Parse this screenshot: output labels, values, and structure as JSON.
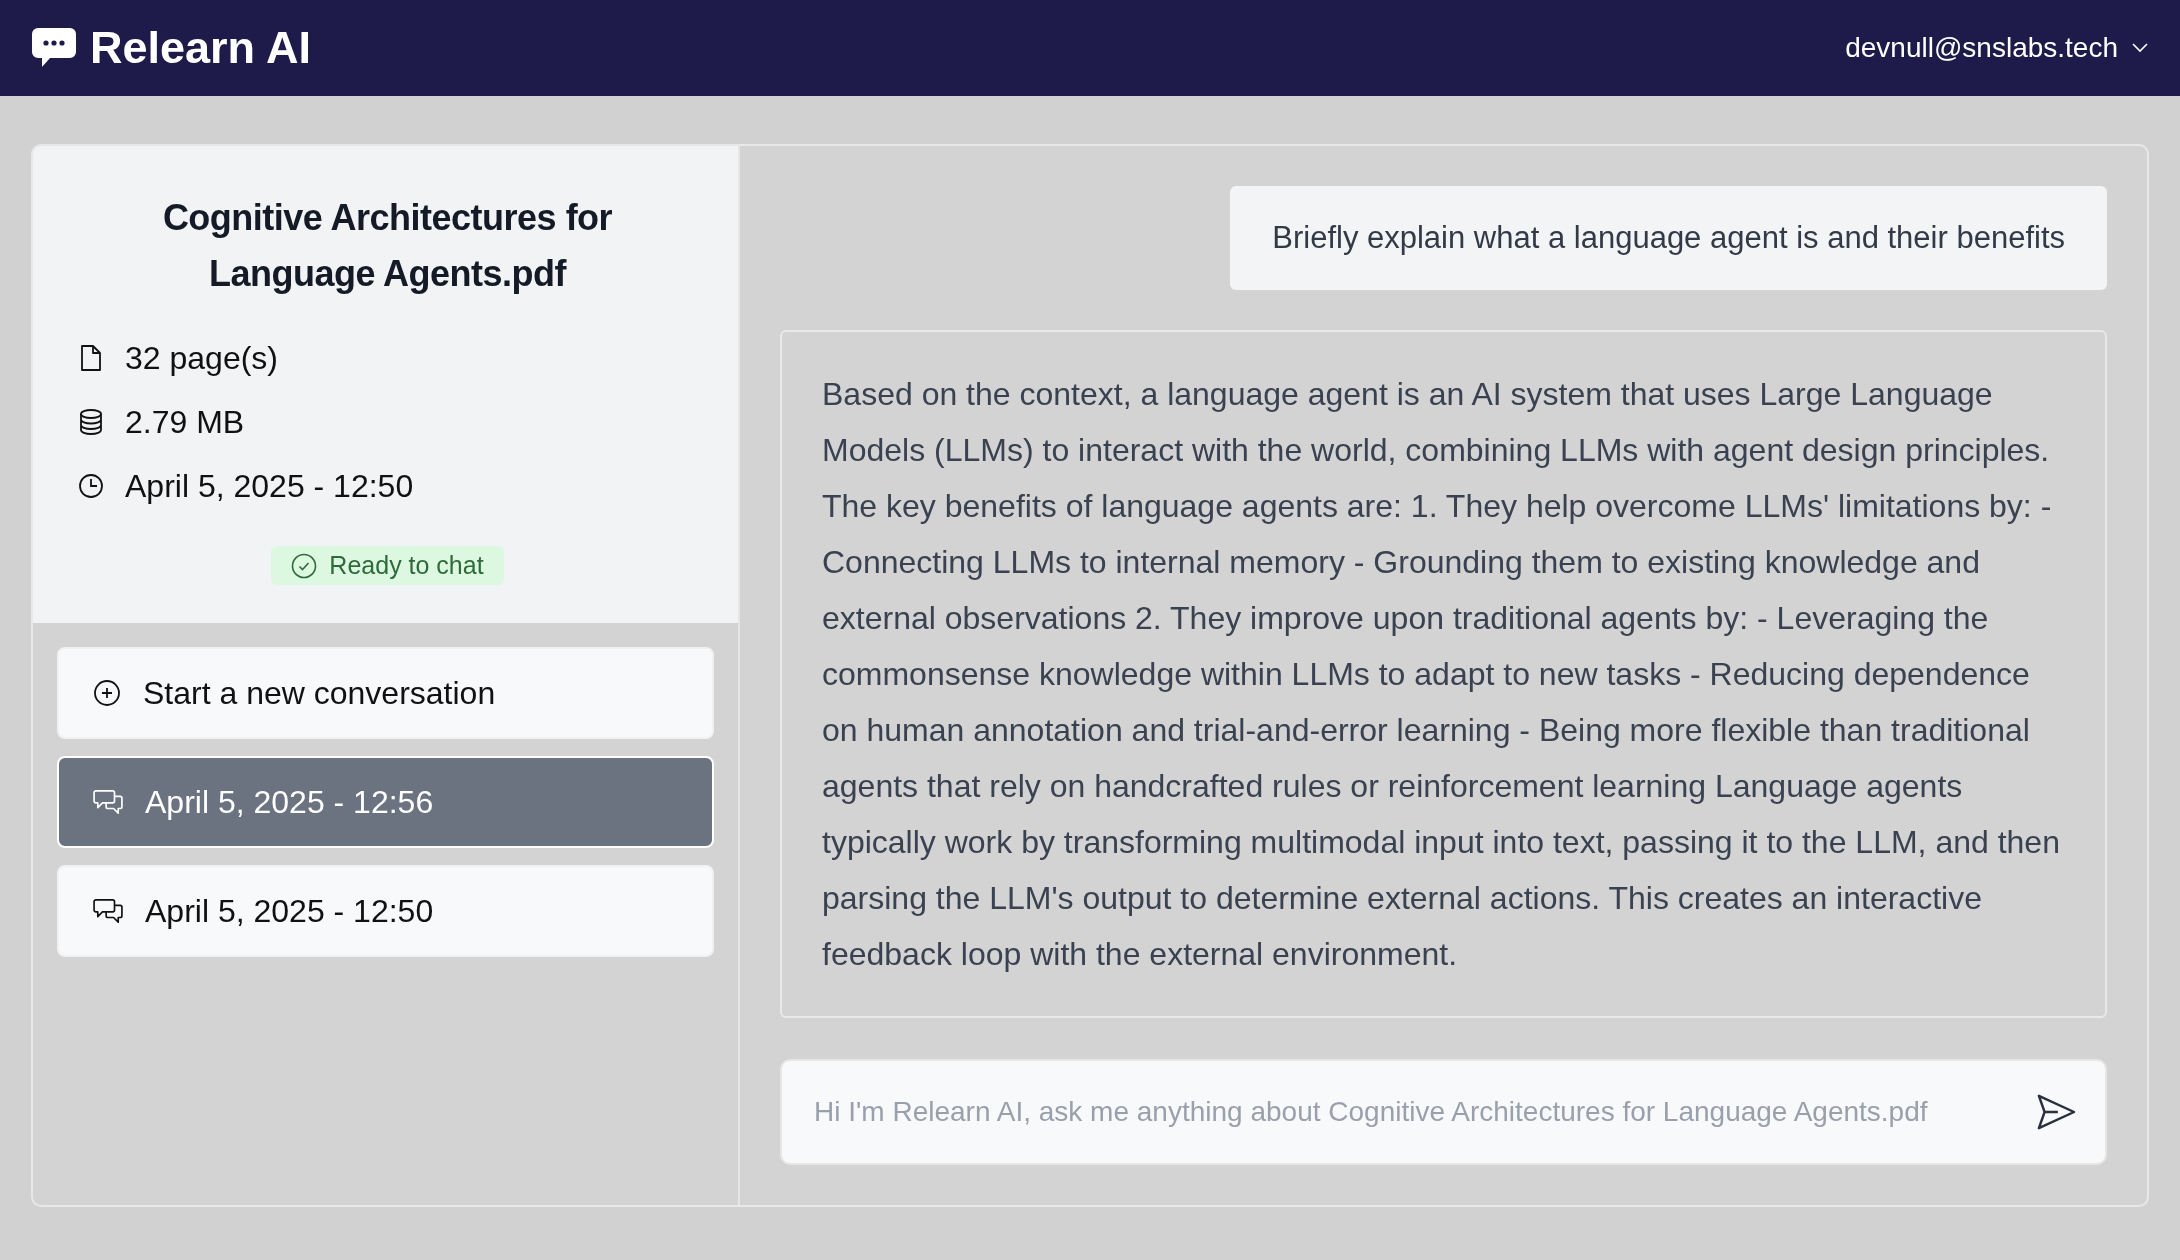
{
  "header": {
    "app_name": "Relearn AI",
    "user_email": "devnull@snslabs.tech"
  },
  "document": {
    "title": "Cognitive Architectures for Language Agents.pdf",
    "pages": "32 page(s)",
    "size": "2.79 MB",
    "uploaded": "April 5, 2025 - 12:50",
    "status": "Ready to chat"
  },
  "new_conversation": "Start a new conversation",
  "conversations": [
    {
      "label": "April 5, 2025 - 12:56",
      "selected": true
    },
    {
      "label": "April 5, 2025 - 12:50",
      "selected": false
    }
  ],
  "messages": [
    {
      "kind": "user",
      "text": "Briefly explain what a language agent is and their benefits"
    },
    {
      "kind": "assistant",
      "text": "Based on the context, a language agent is an AI system that uses Large Language Models (LLMs) to interact with the world, combining LLMs with agent design principles. The key benefits of language agents are: 1. They help overcome LLMs' limitations by: - Connecting LLMs to internal memory - Grounding them to existing knowledge and external observations 2. They improve upon traditional agents by: - Leveraging the commonsense knowledge within LLMs to adapt to new tasks - Reducing dependence on human annotation and trial-and-error learning - Being more flexible than traditional agents that rely on handcrafted rules or reinforcement learning Language agents typically work by transforming multimodal input into text, passing it to the LLM, and then parsing the LLM's output to determine external actions. This creates an interactive feedback loop with the external environment."
    }
  ],
  "composer": {
    "placeholder": "Hi I'm Relearn AI, ask me anything about Cognitive Architectures for Language Agents.pdf"
  }
}
